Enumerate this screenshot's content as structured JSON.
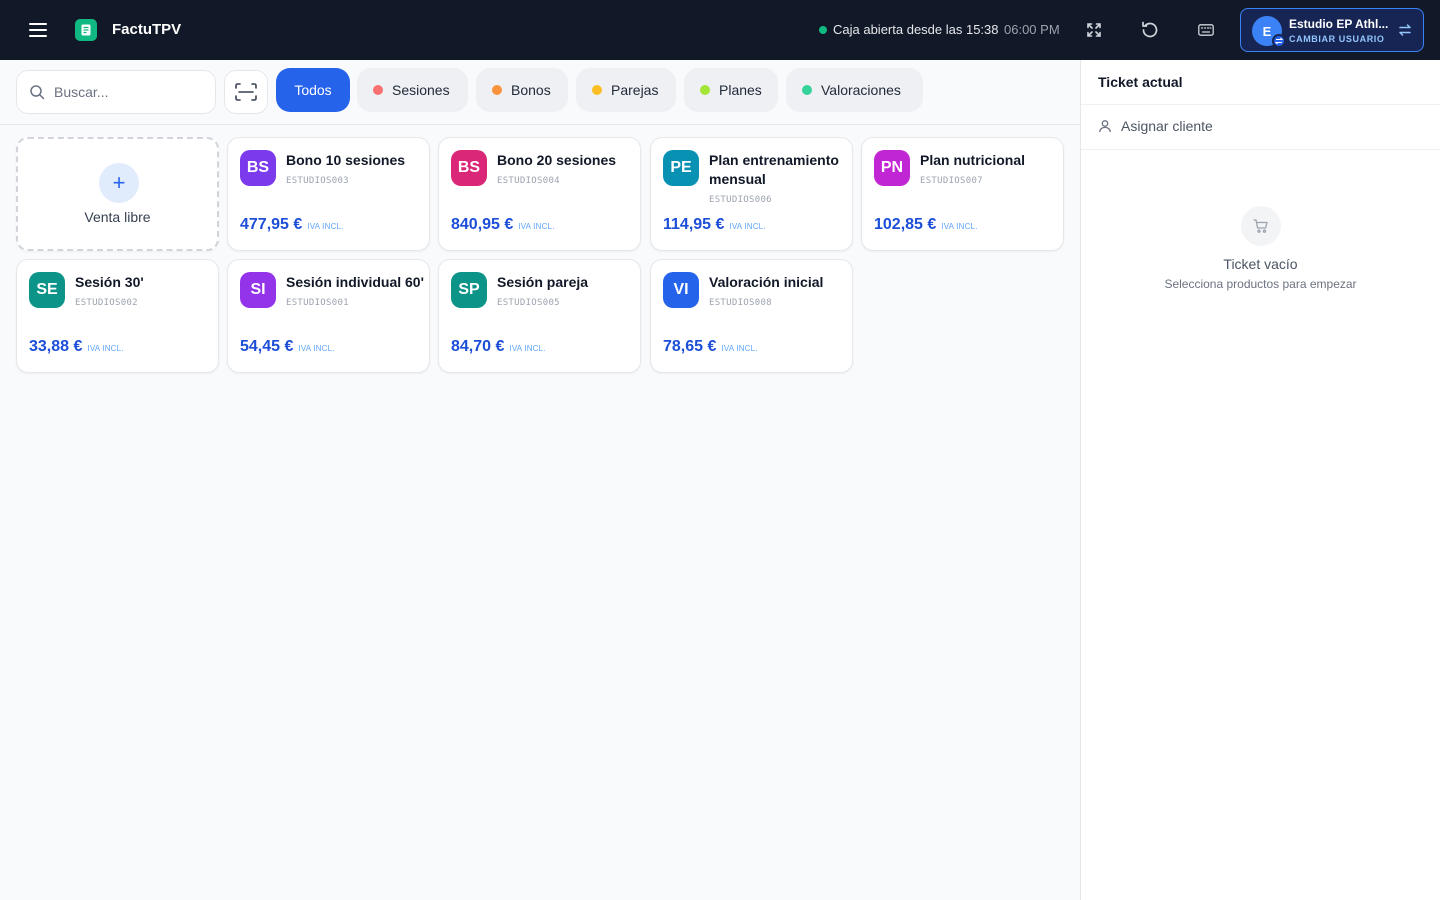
{
  "header": {
    "app_name": "FactuTPV",
    "caja_status": "Caja abierta desde las 15:38",
    "time": "06:00 PM",
    "user": {
      "initial": "E",
      "name": "Estudio EP Athl...",
      "switch_label": "CAMBIAR USUARIO"
    }
  },
  "toolbar": {
    "search_placeholder": "Buscar...",
    "filters": [
      {
        "label": "Todos",
        "active": true
      },
      {
        "label": "Sesiones",
        "color": "#f87171"
      },
      {
        "label": "Bonos",
        "color": "#fb923c"
      },
      {
        "label": "Parejas",
        "color": "#fbbf24"
      },
      {
        "label": "Planes",
        "color": "#a3e635"
      },
      {
        "label": "Valoraciones",
        "color": "#34d399"
      }
    ]
  },
  "products": {
    "free_sale_label": "Venta libre",
    "tax_label": "IVA INCL.",
    "items": [
      {
        "initials": "BS",
        "name": "Bono 10 sesiones",
        "code": "ESTUDIOS003",
        "price": "477,95 €",
        "color": "#7c3aed"
      },
      {
        "initials": "BS",
        "name": "Bono 20 sesiones",
        "code": "ESTUDIOS004",
        "price": "840,95 €",
        "color": "#db2777"
      },
      {
        "initials": "PE",
        "name": "Plan entrenamiento mensual",
        "code": "ESTUDIOS006",
        "price": "114,95 €",
        "color": "#0891b2"
      },
      {
        "initials": "PN",
        "name": "Plan nutricional",
        "code": "ESTUDIOS007",
        "price": "102,85 €",
        "color": "#c026d3"
      },
      {
        "initials": "SE",
        "name": "Sesión 30'",
        "code": "ESTUDIOS002",
        "price": "33,88 €",
        "color": "#0d9488"
      },
      {
        "initials": "SI",
        "name": "Sesión individual 60'",
        "code": "ESTUDIOS001",
        "price": "54,45 €",
        "color": "#9333ea"
      },
      {
        "initials": "SP",
        "name": "Sesión pareja",
        "code": "ESTUDIOS005",
        "price": "84,70 €",
        "color": "#0d9488"
      },
      {
        "initials": "VI",
        "name": "Valoración inicial",
        "code": "ESTUDIOS008",
        "price": "78,65 €",
        "color": "#2563eb"
      }
    ]
  },
  "ticket": {
    "title": "Ticket actual",
    "assign_client": "Asignar cliente",
    "empty_title": "Ticket vacío",
    "empty_subtitle": "Selecciona productos para empezar"
  },
  "icons": {
    "menu": "menu-icon",
    "logo": "receipt-logo-icon",
    "fullscreen": "fullscreen-icon",
    "refresh": "refresh-icon",
    "keyboard": "keyboard-icon",
    "swap": "swap-icon",
    "search": "search-icon",
    "scan": "barcode-scan-icon",
    "plus": "plus-icon",
    "user": "user-icon",
    "cart": "cart-icon"
  }
}
